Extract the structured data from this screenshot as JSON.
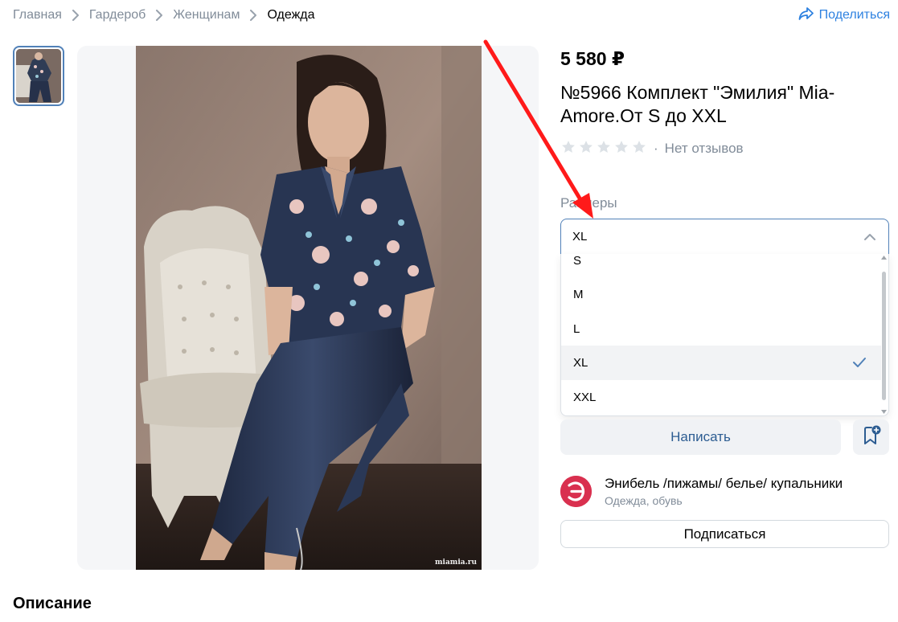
{
  "breadcrumbs": {
    "items": [
      "Главная",
      "Гардероб",
      "Женщинам"
    ],
    "current": "Одежда"
  },
  "share_label": "Поделиться",
  "product": {
    "price": "5 580 ₽",
    "title": "№5966 Комплект \"Эмилия\" Mia-Amore.От S до XXL",
    "rating_text": "Нет отзывов",
    "rating_separator": "·",
    "stars": 0,
    "image_watermark": "miamia.ru"
  },
  "sizes": {
    "label": "Размеры",
    "selected": "XL",
    "options": [
      "S",
      "M",
      "L",
      "XL",
      "XXL"
    ]
  },
  "actions": {
    "write_label": "Написать"
  },
  "shop": {
    "name": "Энибель /пижамы/ белье/ купальники",
    "category": "Одежда, обувь",
    "avatar_letter": "Э",
    "subscribe_label": "Подписаться"
  },
  "description_heading": "Описание",
  "colors": {
    "accent": "#2d81e0",
    "selected_border": "#5181b8",
    "avatar": "#d9304f",
    "annotation_arrow": "#ff1a1a"
  }
}
